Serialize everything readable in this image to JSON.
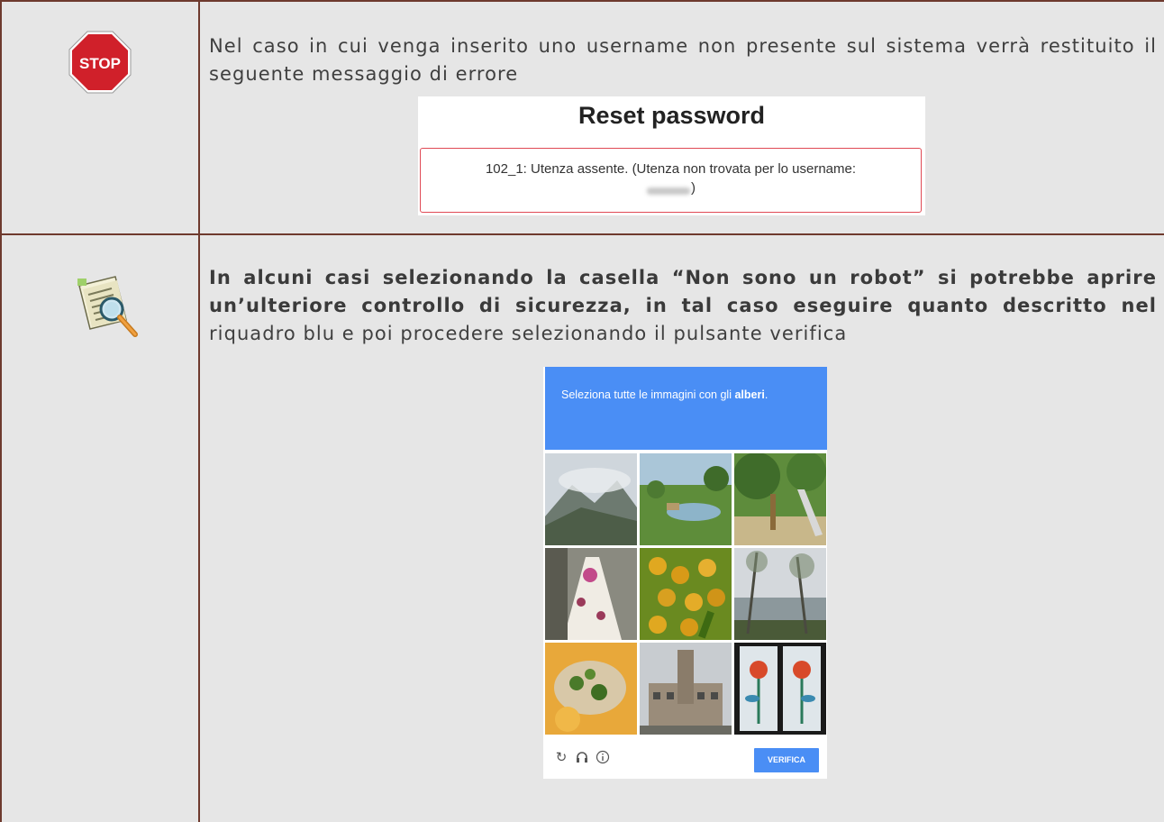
{
  "notes": [
    {
      "icon": "stop-icon",
      "stop_label": "STOP",
      "text": "Nel caso in cui venga inserito uno username non presente sul sistema verrà restituito il seguente messaggio di errore",
      "screenshot": {
        "title": "Reset password",
        "error_message": "102_1: Utenza assente. (Utenza non trovata per lo username:",
        "error_close": ")"
      }
    },
    {
      "icon": "magnifier-document-icon",
      "text_bold": "In alcuni casi selezionando la casella “Non sono un robot” si potrebbe aprire un’ulteriore controllo di sicurezza, in tal caso eseguire quanto descritto nel",
      "text_regular": "riquadro blu e poi procedere selezionando il pulsante verifica",
      "captcha": {
        "instruction_prefix": "Seleziona tutte le immagini con gli",
        "instruction_keyword": "alberi",
        "instruction_suffix": ".",
        "verify_label": "VERIFICA",
        "footer_icons": [
          "reload-icon",
          "headphones-icon",
          "info-icon"
        ]
      }
    }
  ],
  "colors": {
    "border": "#6e3a2e",
    "cell_background": "#e6e6e6",
    "captcha_blue": "#4a8ef5",
    "error_border": "#e04a55",
    "stop_red": "#d0202a"
  }
}
